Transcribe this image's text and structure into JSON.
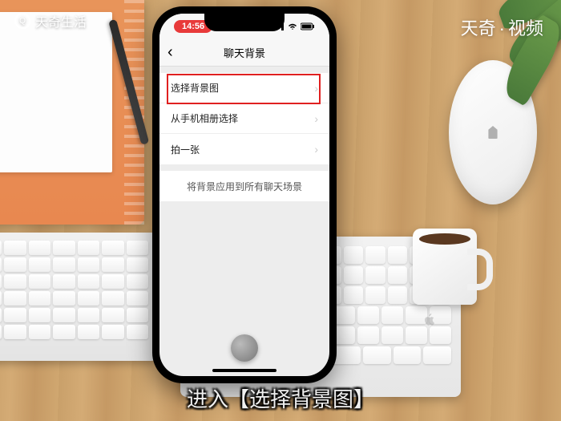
{
  "overlay": {
    "logo_text": "天奇生活",
    "title_left": "天奇",
    "title_sep": "·",
    "title_right": "视频",
    "caption": "进入【选择背景图】"
  },
  "phone": {
    "status": {
      "time": "14:56"
    },
    "nav": {
      "back": "‹",
      "title": "聊天背景"
    },
    "rows": [
      {
        "label": "选择背景图",
        "chevron": "›",
        "highlighted": true
      },
      {
        "label": "从手机相册选择",
        "chevron": "›"
      },
      {
        "label": "拍一张",
        "chevron": "›"
      }
    ],
    "apply_all": "将背景应用到所有聊天场景"
  }
}
